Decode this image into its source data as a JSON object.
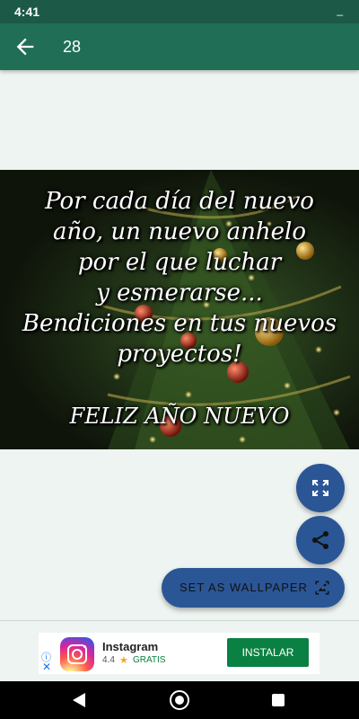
{
  "status_bar": {
    "time": "4:41",
    "indicator": "_"
  },
  "app_bar": {
    "title": "28",
    "back_icon": "arrow-back-icon"
  },
  "wallpaper": {
    "quote_lines": [
      "Por cada día del nuevo",
      "año, un nuevo anhelo",
      "por el que luchar",
      "y esmerarse...",
      "Bendiciones en tus nuevos",
      "proyectos!"
    ],
    "greeting": "FELIZ AÑO NUEVO"
  },
  "actions": {
    "fullscreen_icon": "fullscreen-icon",
    "share_icon": "share-icon",
    "set_wallpaper_label": "SET AS WALLPAPER",
    "wallpaper_icon": "wallpaper-icon"
  },
  "ad": {
    "app_name": "Instagram",
    "rating": "4.4",
    "price": "GRATIS",
    "install_label": "INSTALAR",
    "info_symbol": "ⓘ",
    "close_symbol": "✕",
    "star": "★"
  },
  "colors": {
    "status_bar": "#1c5a47",
    "app_bar": "#206e55",
    "fab": "#2a5696",
    "install": "#0b8043"
  }
}
